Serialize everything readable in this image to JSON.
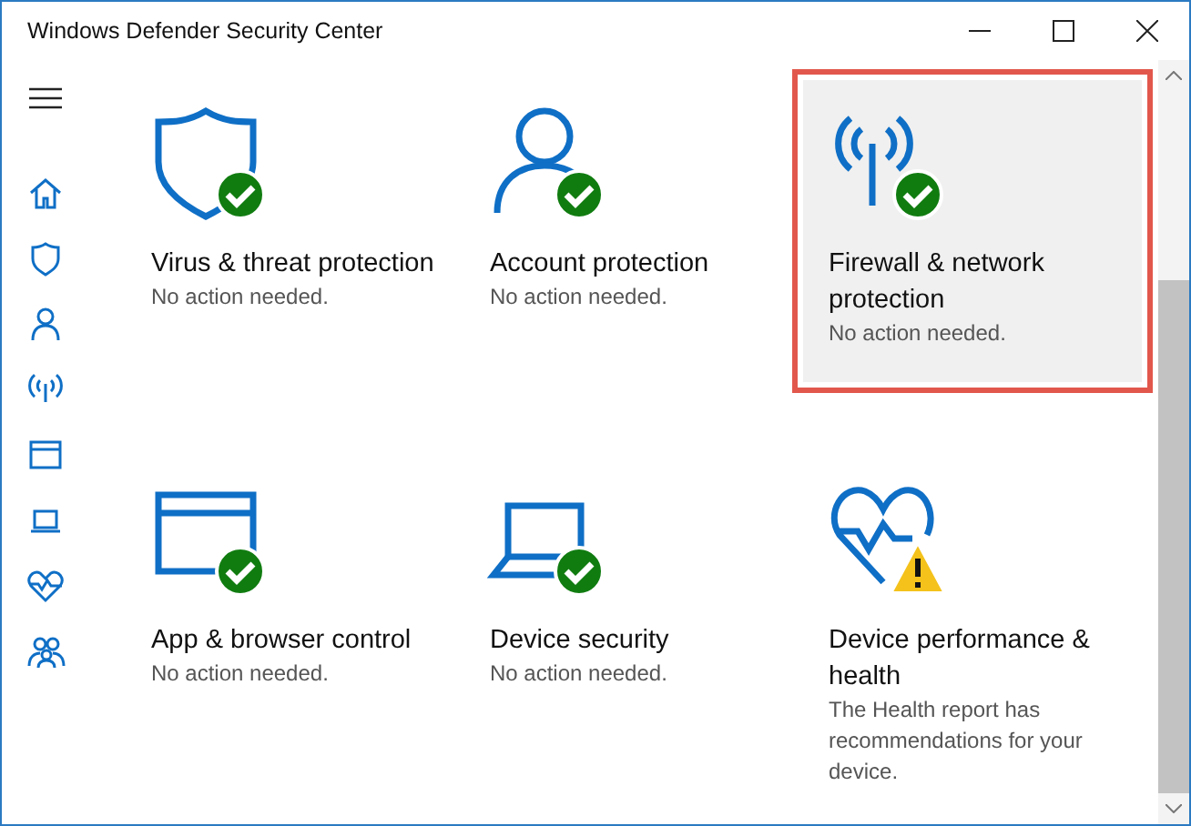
{
  "window": {
    "title": "Windows Defender Security Center"
  },
  "tiles": [
    {
      "kind": "shield",
      "title": "Virus & threat protection",
      "warning": false,
      "message": "No action needed.",
      "selected": false
    },
    {
      "kind": "account",
      "title": "Account protection",
      "warning": false,
      "message": "No action needed.",
      "selected": false
    },
    {
      "kind": "network",
      "title": "Firewall & network protection",
      "warning": false,
      "message": "No action needed.",
      "selected": true
    },
    {
      "kind": "browser",
      "title": "App & browser control",
      "warning": false,
      "message": "No action needed.",
      "selected": false
    },
    {
      "kind": "device",
      "title": "Device security",
      "warning": false,
      "message": "No action needed.",
      "selected": false
    },
    {
      "kind": "health",
      "title": "Device performance & health",
      "warning": true,
      "message": "The Health report has recommendations for your device.",
      "selected": false
    }
  ]
}
